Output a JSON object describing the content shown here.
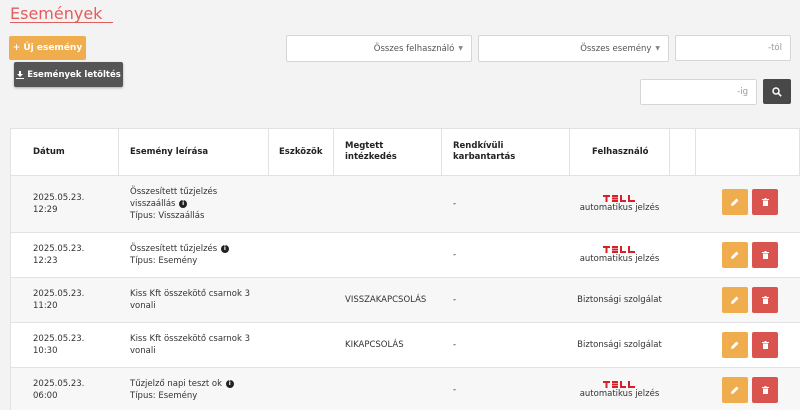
{
  "page": {
    "title": "Események"
  },
  "toolbar": {
    "new_event_label": "Új esemény",
    "download_label": "Események letöltés"
  },
  "filters": {
    "user_select": "Összes felhasználó",
    "event_select": "Összes esemény",
    "from_placeholder": "-tól",
    "to_placeholder": "-ig"
  },
  "table": {
    "columns": {
      "date": "Dátum",
      "description": "Esemény leírása",
      "devices": "Eszközök",
      "action_line1": "Megtett",
      "action_line2": "intézkedés",
      "maintenance_line1": "Rendkívüli",
      "maintenance_line2": "karbantartás",
      "user": "Felhasználó"
    },
    "rows": [
      {
        "date_line1": "2025.05.23.",
        "date_line2": "12:29",
        "desc_line1": "Összesített tűzjelzés",
        "desc_line2": "visszaállás",
        "desc_line3": "Típus: Visszaállás",
        "action": "",
        "maintenance": "-",
        "user_logo": "TELL",
        "user_text": "automatikus jelzés"
      },
      {
        "date_line1": "2025.05.23.",
        "date_line2": "12:23",
        "desc_line1": "Összesített tűzjelzés",
        "desc_line2": "Típus: Esemény",
        "action": "",
        "maintenance": "-",
        "user_logo": "TELL",
        "user_text": "automatikus jelzés"
      },
      {
        "date_line1": "2025.05.23.",
        "date_line2": "11:20",
        "desc_line1": "Kiss Kft összekötő csarnok 3",
        "desc_line2": "vonali",
        "action": "VISSZAKAPCSOLÁS",
        "maintenance": "-",
        "user_text": "Biztonsági szolgálat"
      },
      {
        "date_line1": "2025.05.23.",
        "date_line2": "10:30",
        "desc_line1": "Kiss Kft összekötő csarnok 3",
        "desc_line2": "vonali",
        "action": "KIKAPCSOLÁS",
        "maintenance": "-",
        "user_text": "Biztonsági szolgálat"
      },
      {
        "date_line1": "2025.05.23.",
        "date_line2": "06:00",
        "desc_line1": "Tűzjelző napi teszt ok",
        "desc_line2": "Típus: Esemény",
        "action": "",
        "maintenance": "-",
        "user_logo": "TELL",
        "user_text": "automatikus jelzés"
      }
    ]
  },
  "icons": {
    "plus": "plus-icon",
    "download": "download-icon",
    "search": "search-icon",
    "info": "info-icon",
    "edit": "pencil-icon",
    "delete": "trash-icon"
  },
  "colors": {
    "accent": "#e25d5d",
    "warning": "#f0ad4e",
    "danger": "#d9534f",
    "dark": "#484848",
    "tell_red": "#d6202a"
  }
}
